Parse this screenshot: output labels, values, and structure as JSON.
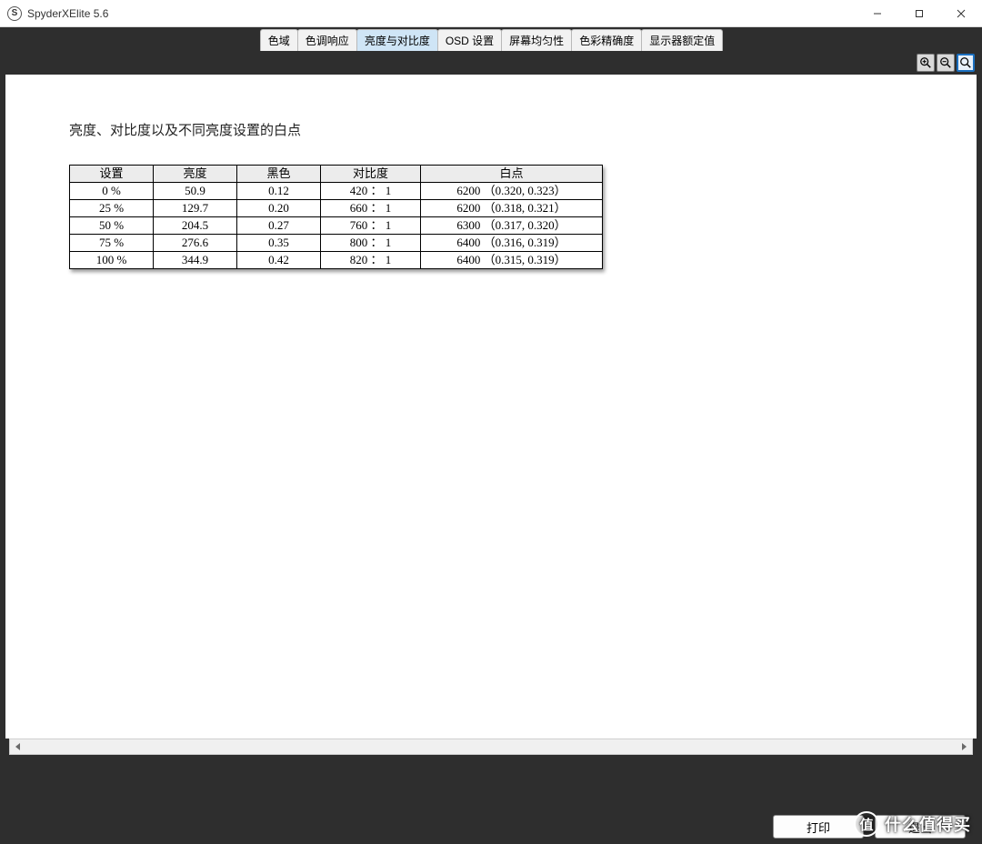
{
  "window": {
    "title": "SpyderXElite 5.6",
    "app_icon_letter": "S"
  },
  "tabs": [
    {
      "label": "色域",
      "active": false
    },
    {
      "label": "色调响应",
      "active": false
    },
    {
      "label": "亮度与对比度",
      "active": true
    },
    {
      "label": "OSD 设置",
      "active": false
    },
    {
      "label": "屏幕均匀性",
      "active": false
    },
    {
      "label": "色彩精确度",
      "active": false
    },
    {
      "label": "显示器额定值",
      "active": false
    }
  ],
  "zoom": {
    "in_name": "zoom-in-icon",
    "out_name": "zoom-out-icon",
    "fit_name": "zoom-fit-icon"
  },
  "page": {
    "heading": "亮度、对比度以及不同亮度设置的白点"
  },
  "table": {
    "headers": {
      "setting": "设置",
      "bright": "亮度",
      "black": "黑色",
      "contrast": "对比度",
      "white": "白点"
    },
    "rows": [
      {
        "setting": "0 %",
        "bright": "50.9",
        "black": "0.12",
        "contrast": "420 ： 1",
        "white": "6200 （0.320, 0.323）"
      },
      {
        "setting": "25 %",
        "bright": "129.7",
        "black": "0.20",
        "contrast": "660 ： 1",
        "white": "6200 （0.318, 0.321）"
      },
      {
        "setting": "50 %",
        "bright": "204.5",
        "black": "0.27",
        "contrast": "760 ： 1",
        "white": "6300 （0.317, 0.320）"
      },
      {
        "setting": "75 %",
        "bright": "276.6",
        "black": "0.35",
        "contrast": "800 ： 1",
        "white": "6400 （0.316, 0.319）"
      },
      {
        "setting": "100 %",
        "bright": "344.9",
        "black": "0.42",
        "contrast": "820 ： 1",
        "white": "6400 （0.315, 0.319）"
      }
    ]
  },
  "buttons": {
    "print": "打印",
    "quit": "退出"
  },
  "watermark": {
    "icon_text": "值",
    "text": "什么值得买"
  }
}
